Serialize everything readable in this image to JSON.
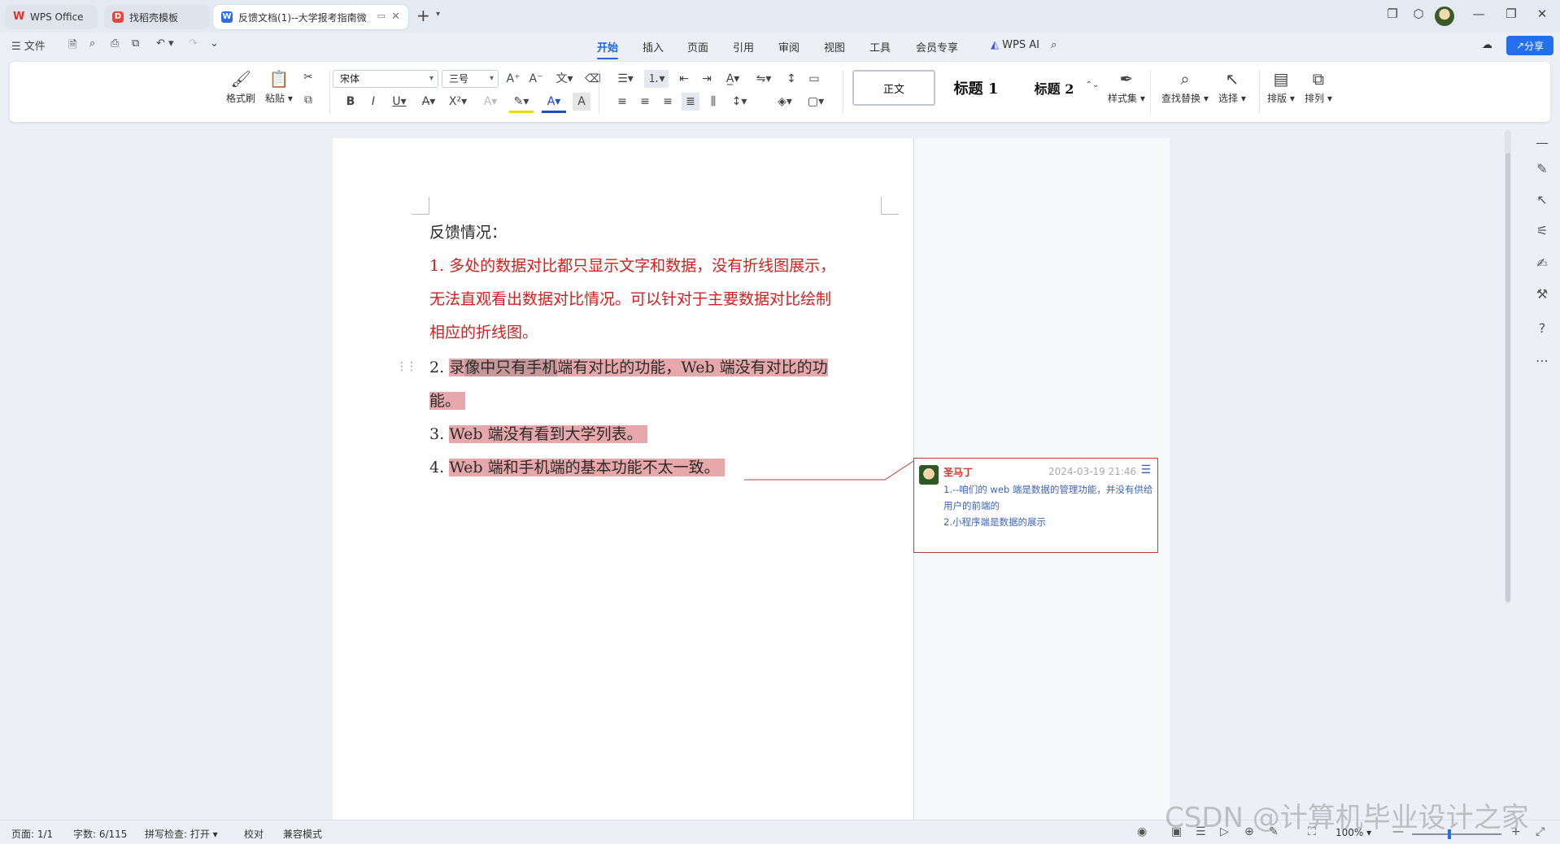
{
  "titlebar": {
    "tabs": [
      {
        "label": "WPS Office"
      },
      {
        "label": "找稻壳模板"
      },
      {
        "label": "反馈文档(1)--大学报考指南微"
      }
    ]
  },
  "menubar": {
    "file_label": "文件",
    "tabs": [
      "开始",
      "插入",
      "页面",
      "引用",
      "审阅",
      "视图",
      "工具",
      "会员专享"
    ],
    "active_tab": "开始",
    "wps_ai_label": "WPS AI",
    "share_label": "分享"
  },
  "ribbon": {
    "format_painter_label": "格式刷",
    "paste_label": "粘贴",
    "font_name": "宋体",
    "font_size": "三号",
    "styles": [
      {
        "label": "正文"
      },
      {
        "label": "标题 1"
      },
      {
        "label": "标题 2"
      }
    ],
    "style_set_label": "样式集",
    "find_replace_label": "查找替换",
    "select_label": "选择",
    "layout_label": "排版",
    "arrange_label": "排列"
  },
  "document": {
    "heading": "反馈情况：",
    "items": [
      {
        "lines": [
          "1. 多处的数据对比都只显示文字和数据，没有折线图展示，",
          "无法直观看出数据对比情况。可以针对于主要数据对比绘制",
          "相应的折线图。"
        ]
      },
      {
        "num": "2.",
        "text_a": "录",
        "text_b": "像中只有手机",
        "text_c": "端有对比的功能，Web 端没有对比的功",
        "line2": "能。"
      },
      {
        "num": "3.",
        "text": "Web 端没有看到大学列表。"
      },
      {
        "num": "4.",
        "text": "Web 端和手机端的基本功能不太一致。"
      }
    ]
  },
  "comment": {
    "author": "圣马丁",
    "time": "2024-03-19 21:46",
    "body_lines": [
      "1.--咱们的 web 端是数据的管理功能，并没有供给",
      "用户的前端的",
      "2.小程序端是数据的展示"
    ]
  },
  "statusbar": {
    "page": "页面: 1/1",
    "words": "字数: 6/115",
    "spell": "拼写检查: 打开",
    "proof": "校对",
    "compat": "兼容模式",
    "zoom": "100%"
  },
  "watermark": "CSDN @计算机毕业设计之家",
  "colors": {
    "accent": "#1c66e8",
    "comment_red": "#d22020",
    "highlight": "#e6a8aa"
  }
}
